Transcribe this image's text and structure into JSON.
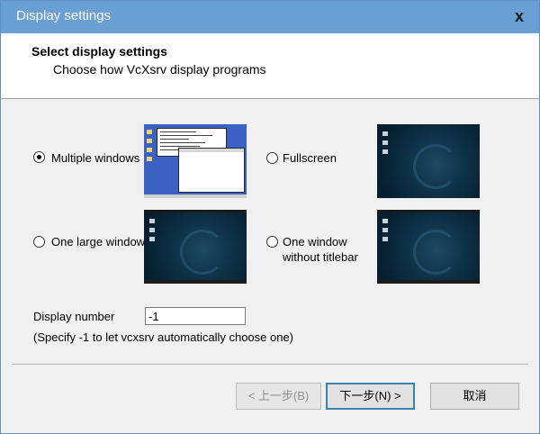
{
  "window": {
    "title": "Display settings",
    "close_glyph": "x"
  },
  "header": {
    "title": "Select display settings",
    "subtitle": "Choose how VcXsrv display programs"
  },
  "options": {
    "multiple_windows": {
      "label": "Multiple windows",
      "selected": true
    },
    "fullscreen": {
      "label": "Fullscreen",
      "selected": false
    },
    "one_large_window": {
      "label": "One large window",
      "selected": false
    },
    "one_window_no_titlebar": {
      "label_line1": "One window",
      "label_line2": "without titlebar",
      "selected": false
    }
  },
  "display_number": {
    "label": "Display number",
    "value": "-1",
    "hint": "(Specify -1 to let vcxsrv automatically choose one)"
  },
  "buttons": {
    "back": "< 上一步(B)",
    "next": "下一步(N) >",
    "cancel": "取消"
  },
  "icons": {
    "close": "close-icon",
    "radio_selected": "radio-dot-icon"
  },
  "colors": {
    "titlebar": "#6a9fd4",
    "dialog_bg": "#f0f0f0",
    "header_bg": "#ffffff",
    "desktop_blue": "#3a62c4",
    "desktop_dark": "#0f3348",
    "default_button_border": "#3c7fb1"
  }
}
